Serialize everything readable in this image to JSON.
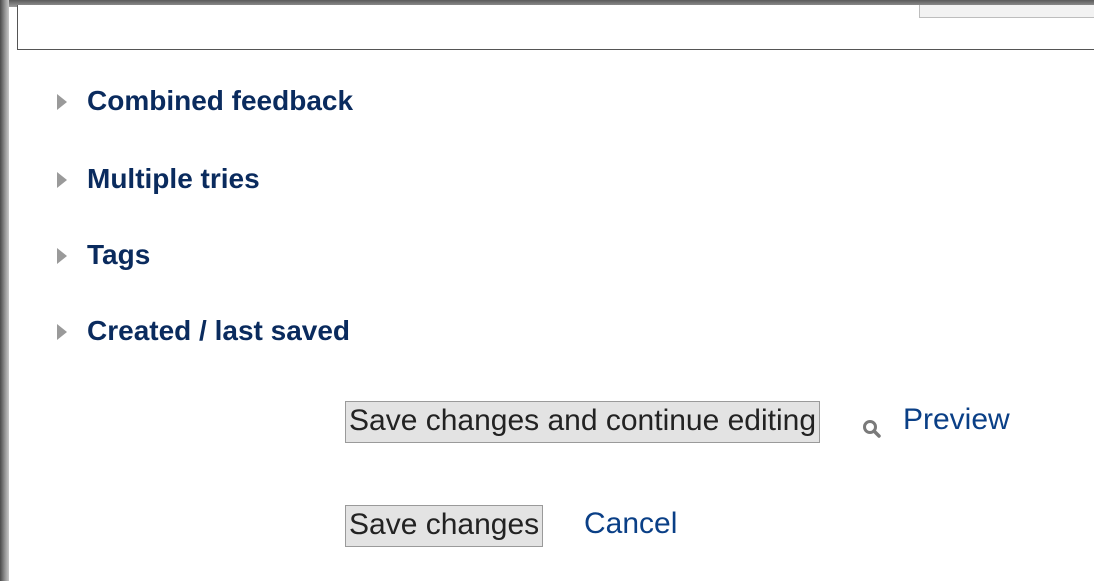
{
  "sections": [
    {
      "label": "Combined feedback"
    },
    {
      "label": "Multiple tries"
    },
    {
      "label": "Tags"
    },
    {
      "label": "Created / last saved"
    }
  ],
  "actions": {
    "save_continue_label": "Save changes and continue editing",
    "preview_label": "Preview",
    "save_label": "Save changes",
    "cancel_label": "Cancel"
  },
  "icons": {
    "section_toggle": "triangle-right-icon",
    "preview": "search-icon"
  },
  "colors": {
    "section_heading": "#0a2b5e",
    "link": "#0a3f86",
    "button_bg": "#e3e3e3"
  }
}
